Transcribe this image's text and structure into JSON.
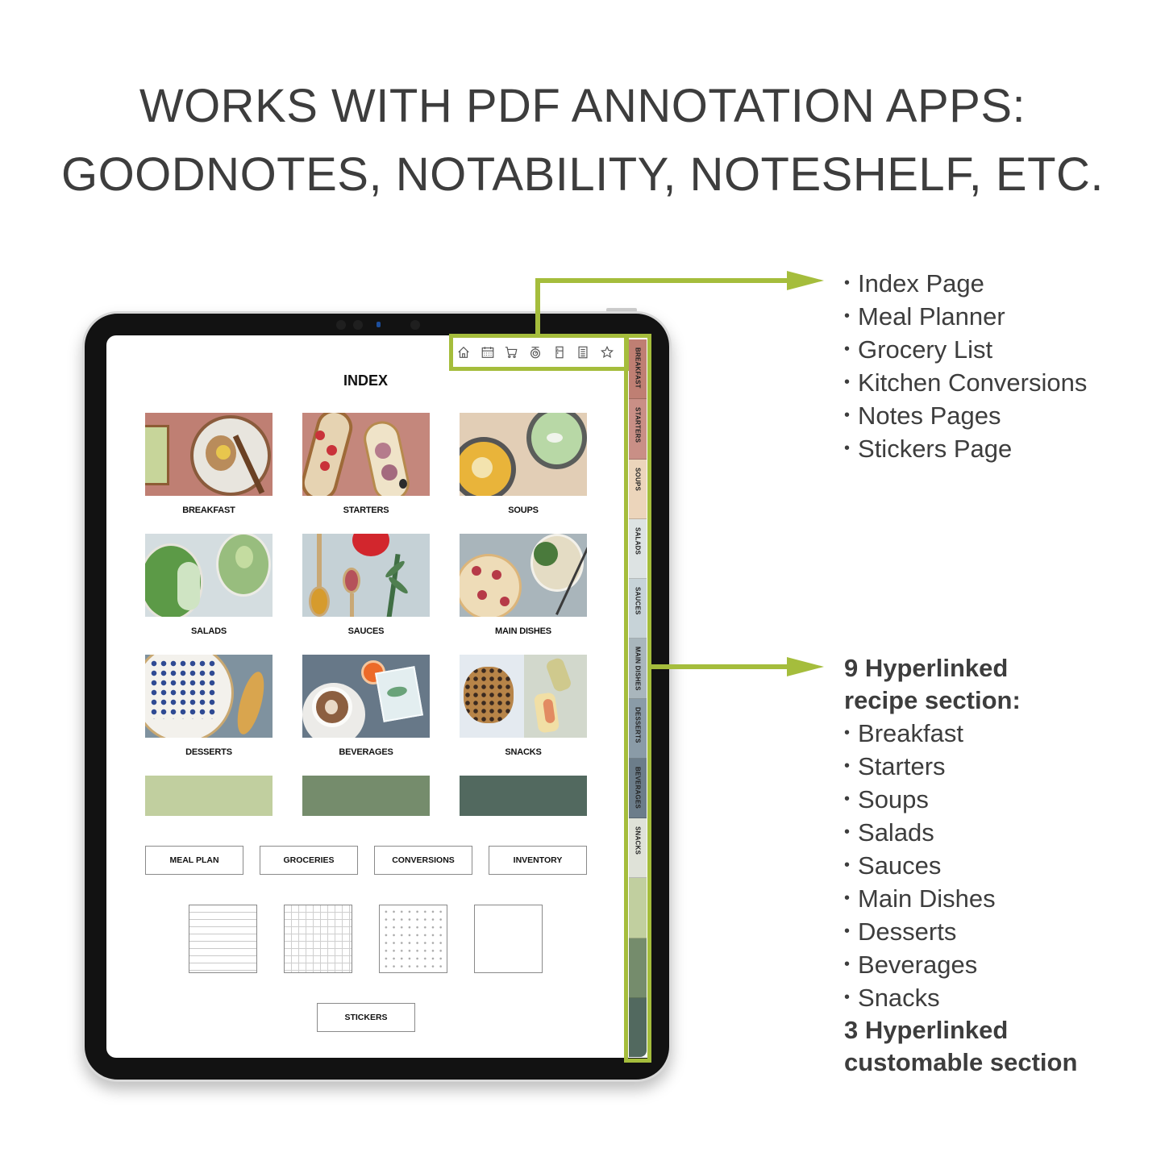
{
  "headline": {
    "line1": "WORKS WITH PDF ANNOTATION APPS:",
    "line2": "GOODNOTES, NOTABILITY, NOTESHELF, ETC."
  },
  "colors": {
    "accent_green": "#a5bd3c",
    "text_dark": "#3d3d3d",
    "tablet_bezel": "#121212"
  },
  "planner": {
    "index_title": "INDEX",
    "toolbar_icons": [
      {
        "name": "home-icon",
        "label": "Home"
      },
      {
        "name": "calendar-icon",
        "label": "Meal Planner"
      },
      {
        "name": "cart-icon",
        "label": "Grocery List"
      },
      {
        "name": "scale-icon",
        "label": "Conversions"
      },
      {
        "name": "fridge-icon",
        "label": "Inventory"
      },
      {
        "name": "notes-icon",
        "label": "Notes"
      },
      {
        "name": "star-icon",
        "label": "Stickers"
      }
    ],
    "categories": [
      {
        "label": "BREAKFAST",
        "bg": "#bf7f73"
      },
      {
        "label": "STARTERS",
        "bg": "#c4877c"
      },
      {
        "label": "SOUPS",
        "bg": "#e2ceb6"
      },
      {
        "label": "SALADS",
        "bg": "#d4dde0"
      },
      {
        "label": "SAUCES",
        "bg": "#c5d1d6"
      },
      {
        "label": "MAIN DISHES",
        "bg": "#a9b5bb"
      },
      {
        "label": "DESSERTS",
        "bg": "#7f929f"
      },
      {
        "label": "BEVERAGES",
        "bg": "#677888"
      },
      {
        "label": "SNACKS",
        "bg": "#d2d8cc"
      }
    ],
    "custom_swatches": [
      "#c1cf9f",
      "#758c6c",
      "#52695f"
    ],
    "nav_buttons": [
      "MEAL PLAN",
      "GROCERIES",
      "CONVERSIONS",
      "INVENTORY"
    ],
    "note_templates": [
      "lined",
      "grid",
      "dotted",
      "blank"
    ],
    "stickers_button": "STICKERS",
    "side_tabs": [
      {
        "label": "BREAKFAST",
        "color": "#bf7f73"
      },
      {
        "label": "STARTERS",
        "color": "#c98f86"
      },
      {
        "label": "SOUPS",
        "color": "#ecd5bb"
      },
      {
        "label": "SALADS",
        "color": "#dde3e3"
      },
      {
        "label": "SAUCES",
        "color": "#c7d3d8"
      },
      {
        "label": "MAIN DISHES",
        "color": "#a9b6bc"
      },
      {
        "label": "DESSERTS",
        "color": "#8a9ba7"
      },
      {
        "label": "BEVERAGES",
        "color": "#6c7d8a"
      },
      {
        "label": "SNACKS",
        "color": "#dfe2d8"
      },
      {
        "label": "",
        "color": "#c1cf9f"
      },
      {
        "label": "",
        "color": "#758c6c"
      },
      {
        "label": "",
        "color": "#52695f"
      }
    ]
  },
  "features_top": [
    "Index Page",
    "Meal Planner",
    "Grocery List",
    "Kitchen Conversions",
    "Notes Pages",
    "Stickers Page"
  ],
  "features_bottom": {
    "heading_line1": "9 Hyperlinked",
    "heading_line2": "recipe section:",
    "items": [
      "Breakfast",
      "Starters",
      "Soups",
      "Salads",
      "Sauces",
      "Main Dishes",
      "Desserts",
      "Beverages",
      "Snacks"
    ],
    "footer_line1": "3 Hyperlinked",
    "footer_line2": "customable section"
  }
}
